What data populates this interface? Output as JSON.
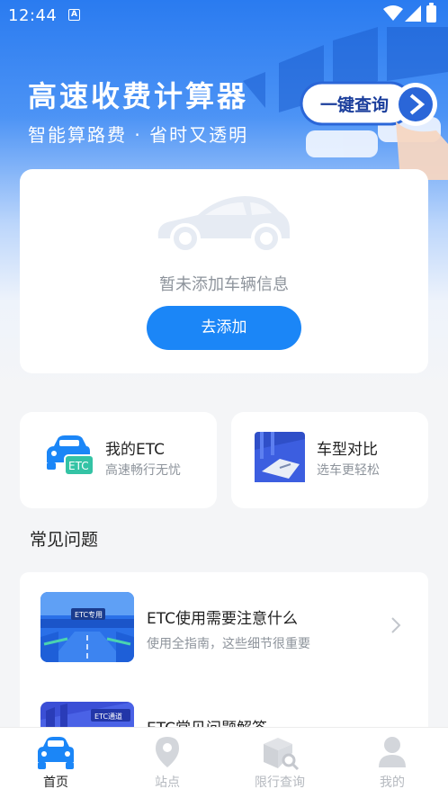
{
  "status_bar": {
    "time": "12:44",
    "notif_letter": "A"
  },
  "hero": {
    "title": "高速收费计算器",
    "subtitle": "智能算路费 · 省时又透明",
    "deco_button": "一键查询"
  },
  "vehicle_card": {
    "empty_text": "暂未添加车辆信息",
    "add_button": "去添加"
  },
  "quick": [
    {
      "title": "我的ETC",
      "subtitle": "高速畅行无忧",
      "badge": "ETC"
    },
    {
      "title": "车型对比",
      "subtitle": "选车更轻松"
    }
  ],
  "faq": {
    "section_title": "常见问题",
    "items": [
      {
        "title": "ETC使用需要注意什么",
        "subtitle": "使用全指南，这些细节很重要",
        "thumb_label": "ETC专用"
      },
      {
        "title": "ETC常见问题解答",
        "subtitle": "",
        "thumb_label": "ETC通道"
      }
    ]
  },
  "tabbar": [
    {
      "label": "首页",
      "icon": "car-icon",
      "active": true
    },
    {
      "label": "站点",
      "icon": "location-pin-icon",
      "active": false
    },
    {
      "label": "限行查询",
      "icon": "box-search-icon",
      "active": false
    },
    {
      "label": "我的",
      "icon": "person-icon",
      "active": false
    }
  ],
  "colors": {
    "primary": "#1b86f7",
    "hero_top": "#2a7bf0",
    "muted": "#8e949c"
  }
}
